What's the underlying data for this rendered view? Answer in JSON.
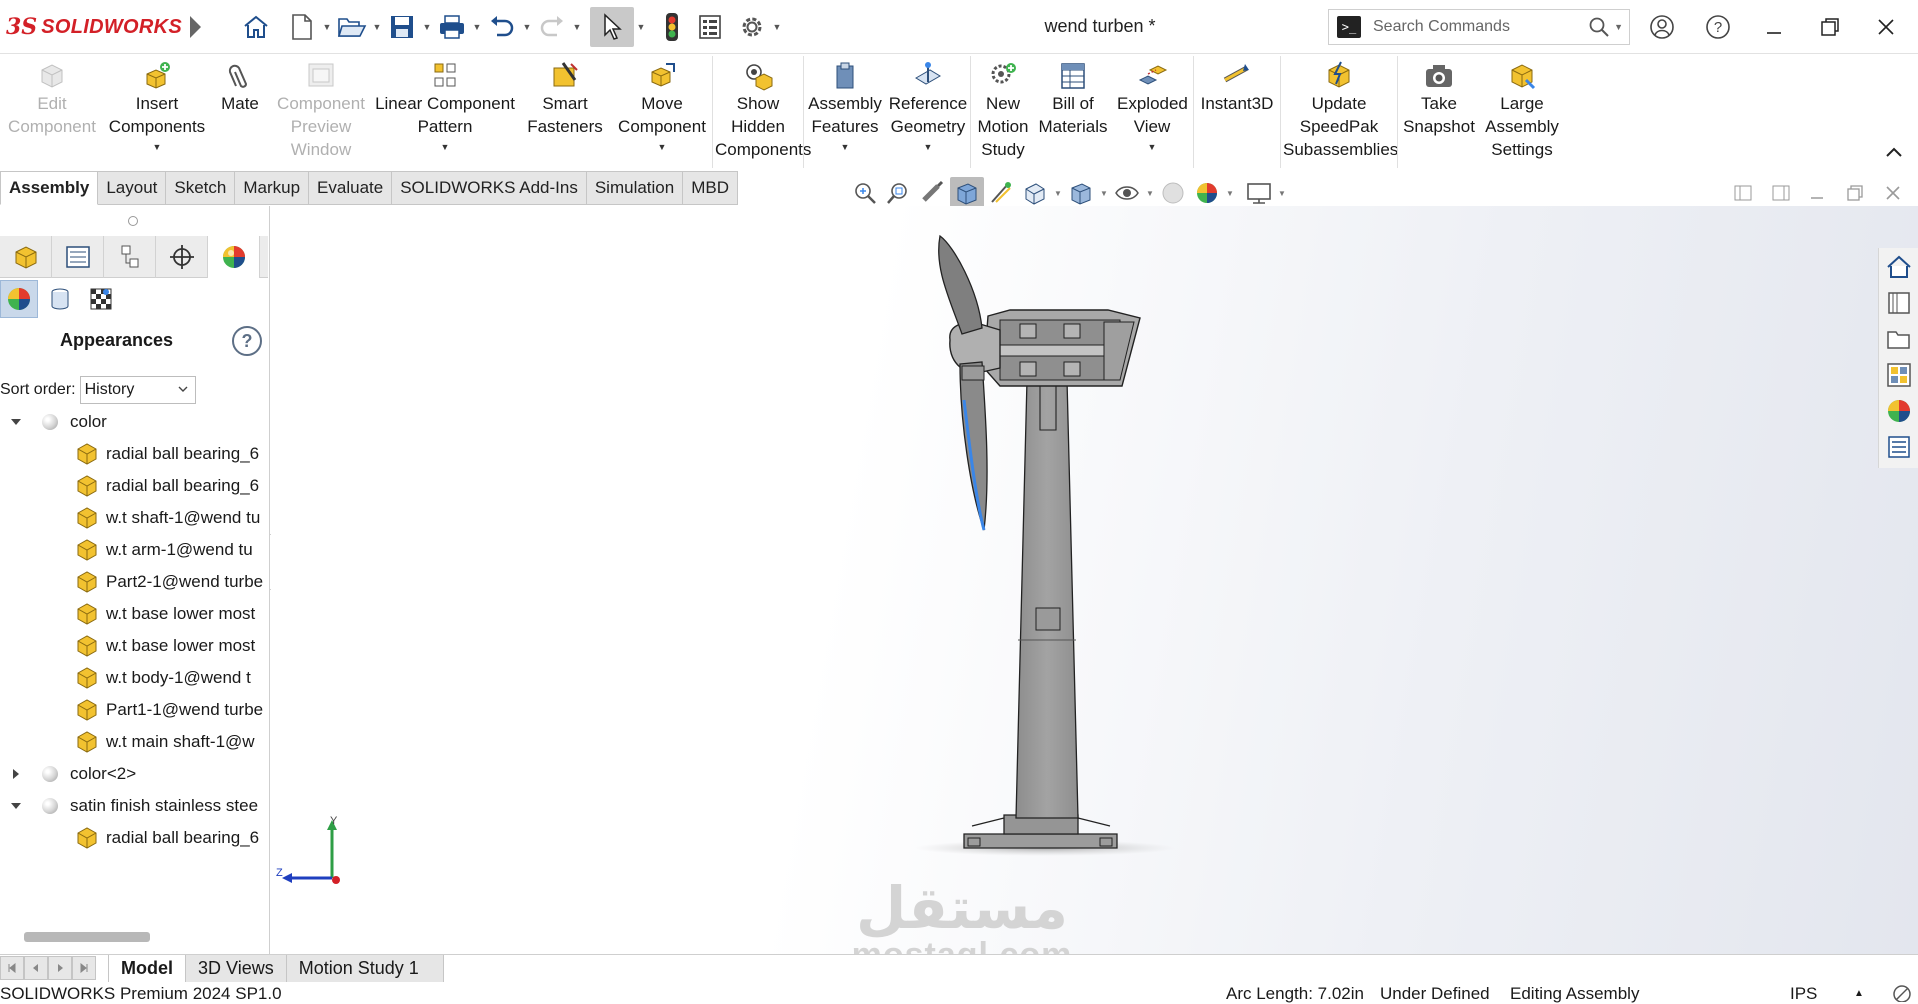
{
  "app": {
    "brand_prefix": "3S",
    "brand_name": "SOLIDWORKS",
    "document_title": "wend turben *"
  },
  "search": {
    "placeholder": "Search Commands"
  },
  "quick_access": [
    "home-icon",
    "new-document-icon",
    "open-icon",
    "save-icon",
    "print-icon",
    "undo-icon",
    "redo-icon",
    "select-icon",
    "rebuild-icon",
    "file-properties-icon",
    "options-icon"
  ],
  "ribbon": {
    "edit_component": "Edit Component",
    "insert_components": "Insert Components",
    "mate": "Mate",
    "component_preview": "Component Preview Window",
    "linear_pattern": "Linear Component Pattern",
    "smart_fasteners": "Smart Fasteners",
    "move_component": "Move Component",
    "show_hidden": "Show Hidden Components",
    "assembly_features": "Assembly Features",
    "reference_geometry": "Reference Geometry",
    "new_motion_study": "New Motion Study",
    "bill_of_materials": "Bill of Materials",
    "exploded_view": "Exploded View",
    "instant3d": "Instant3D",
    "update_speedpak": "Update SpeedPak Subassemblies",
    "take_snapshot": "Take Snapshot",
    "large_assembly": "Large Assembly Settings"
  },
  "tabs": [
    "Assembly",
    "Layout",
    "Sketch",
    "Markup",
    "Evaluate",
    "SOLIDWORKS Add-Ins",
    "Simulation",
    "MBD"
  ],
  "active_tab": "Assembly",
  "panel": {
    "title": "Appearances",
    "help": "?",
    "sort_label": "Sort order:",
    "sort_value": "History",
    "tree": [
      {
        "kind": "appearance",
        "expanded": true,
        "label": "color"
      },
      {
        "kind": "part",
        "label": "radial ball bearing_6"
      },
      {
        "kind": "part",
        "label": "radial ball bearing_6"
      },
      {
        "kind": "part",
        "label": "w.t shaft-1@wend tu"
      },
      {
        "kind": "part",
        "label": "w.t arm-1@wend tu"
      },
      {
        "kind": "part",
        "label": "Part2-1@wend turbe"
      },
      {
        "kind": "part",
        "label": "w.t base lower most"
      },
      {
        "kind": "part",
        "label": "w.t base lower most"
      },
      {
        "kind": "part",
        "label": "w.t body-1@wend t"
      },
      {
        "kind": "part",
        "label": "Part1-1@wend turbe"
      },
      {
        "kind": "part",
        "label": "w.t main shaft-1@w"
      },
      {
        "kind": "appearance",
        "expanded": false,
        "label": "color<2>"
      },
      {
        "kind": "appearance",
        "expanded": true,
        "label": "satin finish stainless stee"
      },
      {
        "kind": "part",
        "label": "radial ball bearing_6"
      }
    ]
  },
  "triad": {
    "y": "Y",
    "z": "Z"
  },
  "watermark": {
    "arabic": "مستقل",
    "latin": "mostaql.com"
  },
  "bottom_tabs": [
    "Model",
    "3D Views",
    "Motion Study 1"
  ],
  "active_bottom_tab": "Model",
  "status": {
    "product": "SOLIDWORKS Premium 2024 SP1.0",
    "arc_length": "Arc Length: 7.02in",
    "definition": "Under Defined",
    "mode": "Editing Assembly",
    "units": "IPS"
  },
  "colors": {
    "brand_red": "#d32027",
    "part_yellow": "#f2c230",
    "model_gray": "#9a9a9a",
    "highlight_blue": "#3a86e8"
  }
}
